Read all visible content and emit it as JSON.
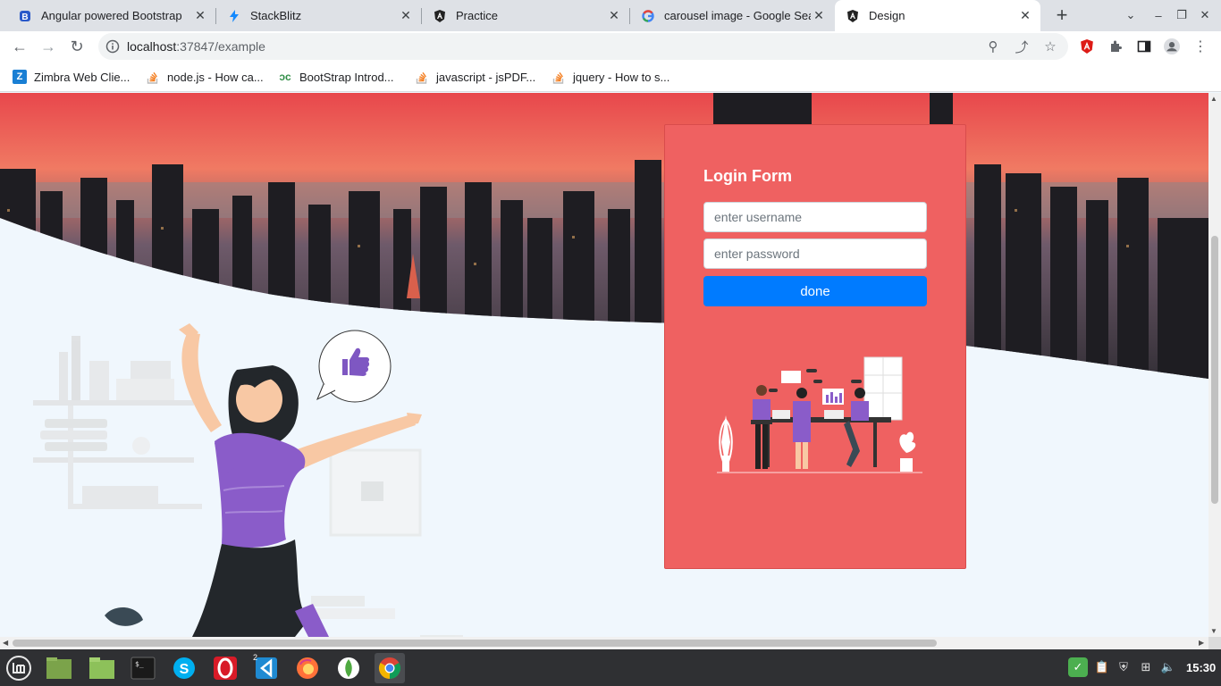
{
  "browser": {
    "tabs": [
      {
        "title": "Angular powered Bootstrap",
        "icon": "bootstrap-icon",
        "active": false
      },
      {
        "title": "StackBlitz",
        "icon": "stackblitz-icon",
        "active": false
      },
      {
        "title": "Practice",
        "icon": "angular-icon",
        "active": false
      },
      {
        "title": "carousel image - Google Sea",
        "icon": "google-icon",
        "active": false
      },
      {
        "title": "Design",
        "icon": "angular-icon",
        "active": true
      }
    ],
    "url_host": "localhost",
    "url_rest": ":37847/example",
    "bookmarks": [
      {
        "label": "Zimbra Web Clie...",
        "icon": "zimbra-icon"
      },
      {
        "label": "node.js - How ca...",
        "icon": "stackoverflow-icon"
      },
      {
        "label": "BootStrap Introd...",
        "icon": "geeksforgeeks-icon"
      },
      {
        "label": "javascript - jsPDF...",
        "icon": "stackoverflow-icon"
      },
      {
        "label": "jquery - How to s...",
        "icon": "stackoverflow-icon"
      }
    ]
  },
  "login": {
    "title": "Login Form",
    "username_placeholder": "enter username",
    "password_placeholder": "enter password",
    "submit_label": "done"
  },
  "taskbar": {
    "apps": [
      "menu-icon",
      "files-icon",
      "folder-icon",
      "terminal-icon",
      "skype-icon",
      "opera-icon",
      "vscode-icon",
      "firefox-icon",
      "mongodb-icon",
      "chrome-icon"
    ],
    "vscode_badge": "2",
    "clock": "15:30"
  },
  "colors": {
    "card": "#ef6161",
    "button": "#007bff",
    "shirt": "#8a5cc9",
    "page_bg": "#f0f7fd"
  }
}
